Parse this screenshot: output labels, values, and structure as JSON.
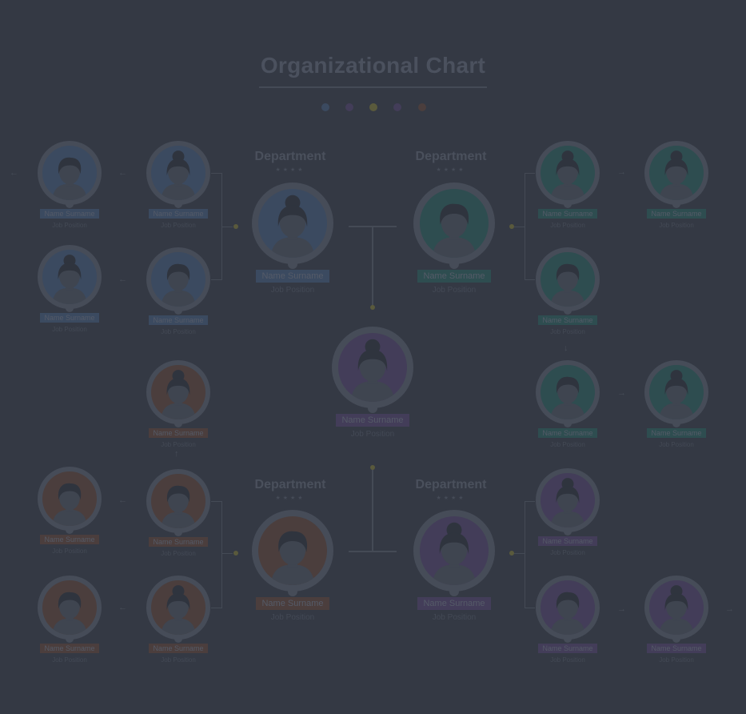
{
  "title": "Organizational Chart",
  "colors": {
    "background": "#343944",
    "blue": "#3b4a60",
    "teal": "#2e4d50",
    "purple": "#433d59",
    "orange": "#4b3e3d",
    "olive": "#5a5a3c"
  },
  "legend_dots": [
    "blue",
    "purple",
    "olive",
    "purple",
    "orange"
  ],
  "departments": [
    {
      "label": "Department",
      "stars": "★★★★"
    },
    {
      "label": "Department",
      "stars": "★★★★"
    },
    {
      "label": "Department",
      "stars": "★★★★"
    },
    {
      "label": "Department",
      "stars": "★★★★"
    }
  ],
  "center": {
    "name": "Name Surname",
    "position": "Job Position",
    "color": "purple",
    "hair": "bun"
  },
  "heads": [
    {
      "name": "Name Surname",
      "position": "Job Position",
      "color": "blue",
      "hair": "bun"
    },
    {
      "name": "Name Surname",
      "position": "Job Position",
      "color": "teal",
      "hair": "short"
    },
    {
      "name": "Name Surname",
      "position": "Job Position",
      "color": "orange",
      "hair": "short"
    },
    {
      "name": "Name Surname",
      "position": "Job Position",
      "color": "purple",
      "hair": "bun"
    }
  ],
  "members": [
    {
      "name": "Name Surname",
      "position": "Job Position",
      "color": "blue",
      "hair": "short"
    },
    {
      "name": "Name Surname",
      "position": "Job Position",
      "color": "blue",
      "hair": "bun"
    },
    {
      "name": "Name Surname",
      "position": "Job Position",
      "color": "blue",
      "hair": "bun"
    },
    {
      "name": "Name Surname",
      "position": "Job Position",
      "color": "blue",
      "hair": "short"
    },
    {
      "name": "Name Surname",
      "position": "Job Position",
      "color": "teal",
      "hair": "bun"
    },
    {
      "name": "Name Surname",
      "position": "Job Position",
      "color": "teal",
      "hair": "bun"
    },
    {
      "name": "Name Surname",
      "position": "Job Position",
      "color": "teal",
      "hair": "short"
    },
    {
      "name": "Name Surname",
      "position": "Job Position",
      "color": "teal",
      "hair": "short"
    },
    {
      "name": "Name Surname",
      "position": "Job Position",
      "color": "teal",
      "hair": "bun"
    },
    {
      "name": "Name Surname",
      "position": "Job Position",
      "color": "orange",
      "hair": "bun"
    },
    {
      "name": "Name Surname",
      "position": "Job Position",
      "color": "orange",
      "hair": "short"
    },
    {
      "name": "Name Surname",
      "position": "Job Position",
      "color": "orange",
      "hair": "short"
    },
    {
      "name": "Name Surname",
      "position": "Job Position",
      "color": "orange",
      "hair": "short"
    },
    {
      "name": "Name Surname",
      "position": "Job Position",
      "color": "orange",
      "hair": "bun"
    },
    {
      "name": "Name Surname",
      "position": "Job Position",
      "color": "purple",
      "hair": "bun"
    },
    {
      "name": "Name Surname",
      "position": "Job Position",
      "color": "purple",
      "hair": "short"
    },
    {
      "name": "Name Surname",
      "position": "Job Position",
      "color": "purple",
      "hair": "bun"
    }
  ]
}
